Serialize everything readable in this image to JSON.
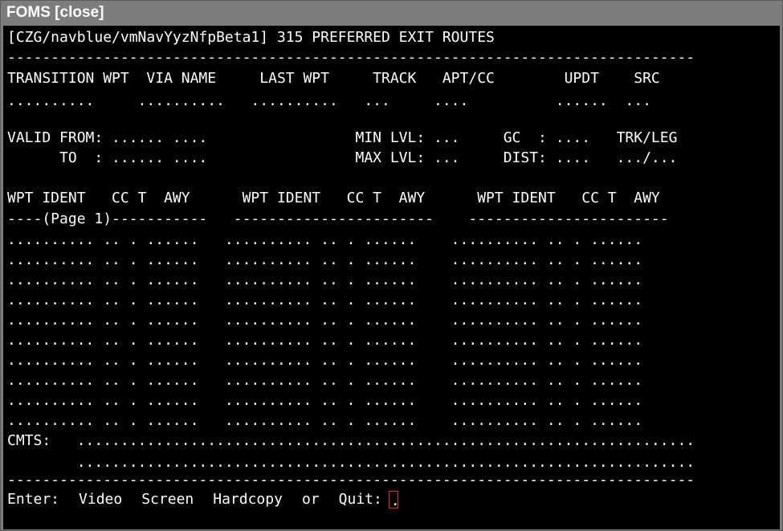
{
  "window": {
    "title": "FOMS",
    "close_label": "[close]"
  },
  "screen": {
    "header": "[CZG/navblue/vmNavYyzNfpBeta1] 315 PREFERRED EXIT ROUTES",
    "separator_top": "-------------------------------------------------------------------------------",
    "columns_header": "TRANSITION WPT  VIA NAME     LAST WPT     TRACK   APT/CC        UPDT    SRC",
    "columns_values": "..........     ..........   ..........   ...     ....          ......  ...",
    "valid_from": "VALID FROM: ...... ....                 MIN LVL: ...     GC  : ....   TRK/LEG",
    "valid_to": "      TO  : ...... ....                 MAX LVL: ...     DIST: ....   .../...",
    "table_header": "WPT IDENT   CC T  AWY      WPT IDENT   CC T  AWY      WPT IDENT   CC T  AWY",
    "table_separator": "----(Page 1)-----------   -----------------------    -----------------------",
    "table_rows": [
      ".......... .. . ......   .......... .. . ......    .......... .. . ......",
      ".......... .. . ......   .......... .. . ......    .......... .. . ......",
      ".......... .. . ......   .......... .. . ......    .......... .. . ......",
      ".......... .. . ......   .......... .. . ......    .......... .. . ......",
      ".......... .. . ......   .......... .. . ......    .......... .. . ......",
      ".......... .. . ......   .......... .. . ......    .......... .. . ......",
      ".......... .. . ......   .......... .. . ......    .......... .. . ......",
      ".......... .. . ......   .......... .. . ......    .......... .. . ......",
      ".......... .. . ......   .......... .. . ......    .......... .. . ......",
      ".......... .. . ......   .......... .. . ......    .......... .. . ......"
    ],
    "cmts_line1": "CMTS:   .......................................................................",
    "cmts_line2": "        .......................................................................",
    "separator_bottom": "-------------------------------------------------------------------------------",
    "prompt": {
      "label": "Enter:",
      "video": "Video",
      "screen": "Screen",
      "hardcopy": "Hardcopy",
      "or": "or",
      "quit": "Quit:",
      "input_value": "."
    }
  },
  "colors": {
    "terminal_bg": "#000000",
    "terminal_fg": "#ffffff",
    "titlebar_bg": "#7d7d7d",
    "cursor_border": "#ff2020"
  }
}
